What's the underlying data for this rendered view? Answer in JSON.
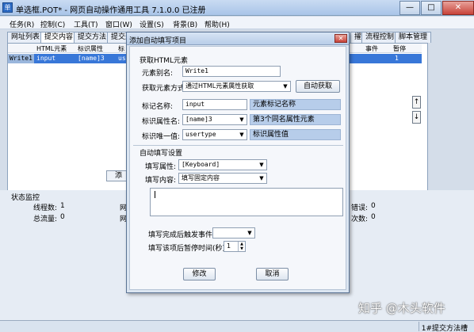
{
  "window": {
    "icon_char": "单",
    "title": "单选框.POT* - 网页自动操作通用工具 7.1.0.0 已注册",
    "minimize": "—",
    "maximize": "□",
    "close": "✕"
  },
  "menu": [
    "任务(R)",
    "控制(C)",
    "工具(T)",
    "窗口(W)",
    "设置(S)",
    "背景(B)",
    "帮助(H)"
  ],
  "tabs": [
    "网址列表",
    "提交内容",
    "提交方法",
    "提交",
    "流程控制",
    "脚本管理"
  ],
  "tab_partial_left": "提交选",
  "tab_partial_right": "擢",
  "grid": {
    "headers": [
      "HTML元素",
      "标识属性",
      "标",
      "事件",
      "暂停"
    ],
    "row": {
      "name": "Write1",
      "element": "input",
      "attr": "[name]3",
      "unique_partial": "us",
      "pause": "1"
    }
  },
  "add_button_partial": "添",
  "scroll_up": "↑",
  "scroll_down": "↓",
  "status": {
    "section_title": "状态监控",
    "threads_label": "线程数:",
    "threads_value": "1",
    "flow_label": "总流量:",
    "flow_value": "0",
    "partial_net_1": "网",
    "partial_net_2": "网",
    "errors_partial": "错误:",
    "errors_value": "0",
    "count_partial": "次数:",
    "count_value": "0"
  },
  "bottom_status": "1#提交方法槽",
  "watermark": "知乎 @木头软件",
  "dialog": {
    "title": "添加自动填写项目",
    "close": "✕",
    "section_get": "获取HTML元素",
    "alias_label": "元素别名:",
    "alias_value": "Write1",
    "method_label": "获取元素方式",
    "method_value": "通过HTML元素属性获取",
    "auto_get_button": "自动获取",
    "tag_label": "标记名称:",
    "tag_value": "input",
    "tag_hint": "元素标记名称",
    "attr_label": "标识属性名:",
    "attr_value": "[name]3",
    "attr_hint": "第3个同名属性元素",
    "unique_label": "标识唯一值:",
    "unique_value": "usertype",
    "unique_hint": "标识属性值",
    "section_fill": "自动填写设置",
    "fill_attr_label": "填写属性:",
    "fill_attr_value": "[Keyboard]",
    "fill_content_label": "填写内容:",
    "fill_content_value": "填写固定内容",
    "trigger_label": "填写完成后触发事件",
    "pause_label": "填写该项后暂停时间(秒)",
    "pause_value": "1",
    "modify_button": "修改",
    "cancel_button": "取消"
  }
}
